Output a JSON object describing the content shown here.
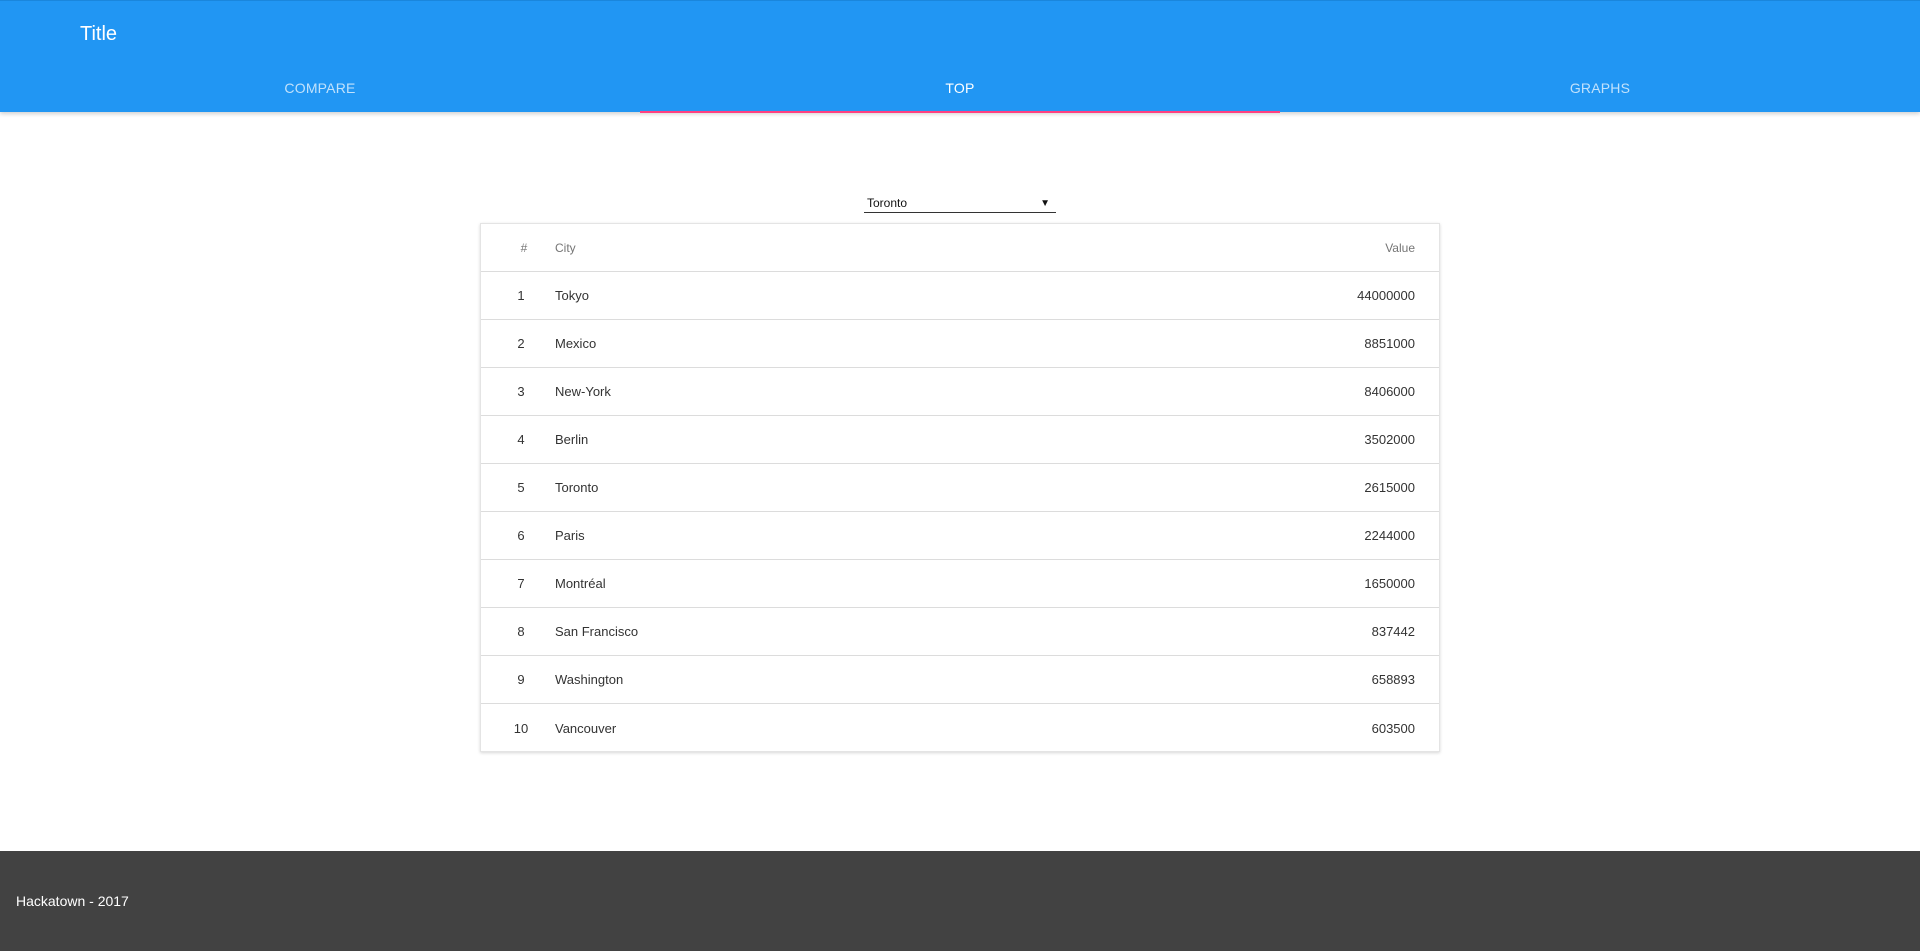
{
  "header": {
    "title": "Title",
    "tabs": [
      {
        "label": "COMPARE"
      },
      {
        "label": "TOP"
      },
      {
        "label": "GRAPHS"
      }
    ],
    "active_tab": 1,
    "accent_color": "#2196f3",
    "indicator_color": "#ff4081"
  },
  "selector": {
    "selected": "Toronto",
    "arrow": "▼"
  },
  "table": {
    "columns": {
      "rank": "#",
      "city": "City",
      "value": "Value"
    },
    "rows": [
      {
        "rank": "1",
        "city": "Tokyo",
        "value": "44000000"
      },
      {
        "rank": "2",
        "city": "Mexico",
        "value": "8851000"
      },
      {
        "rank": "3",
        "city": "New-York",
        "value": "8406000"
      },
      {
        "rank": "4",
        "city": "Berlin",
        "value": "3502000"
      },
      {
        "rank": "5",
        "city": "Toronto",
        "value": "2615000"
      },
      {
        "rank": "6",
        "city": "Paris",
        "value": "2244000"
      },
      {
        "rank": "7",
        "city": "Montréal",
        "value": "1650000"
      },
      {
        "rank": "8",
        "city": "San Francisco",
        "value": "837442"
      },
      {
        "rank": "9",
        "city": "Washington",
        "value": "658893"
      },
      {
        "rank": "10",
        "city": "Vancouver",
        "value": "603500"
      }
    ]
  },
  "footer": {
    "text": "Hackatown - 2017"
  }
}
